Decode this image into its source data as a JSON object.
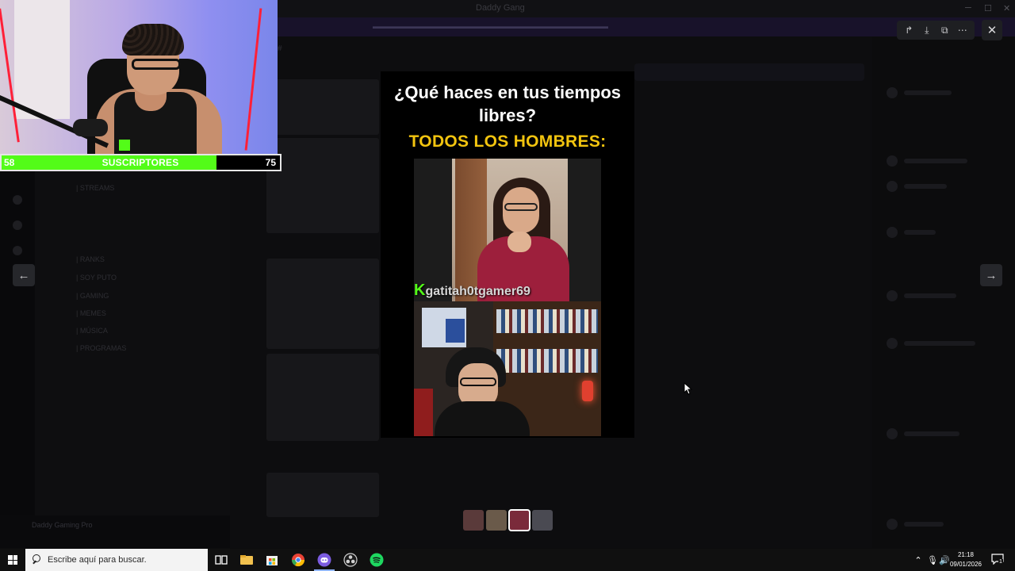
{
  "background_app": {
    "title": "Daddy Gang",
    "channels": [
      "| STREAMS",
      "| RANKS",
      "| SOY PUTO",
      "| GAMING",
      "| MEMES",
      "| MÚSICA",
      "| PROGRAMAS"
    ],
    "user_panel_name": "Daddy Gaming Pro"
  },
  "webcam_overlay": {
    "subs_bar": {
      "current": "58",
      "label": "SUSCRIPTORES",
      "goal": "75",
      "progress_fraction": 0.773
    }
  },
  "media_viewer": {
    "toolbar": {
      "forward_icon": "forward-icon",
      "download_icon": "download-icon",
      "open_external_icon": "open-external-icon",
      "more_icon": "more-icon"
    },
    "close_icon": "close-icon",
    "prev_icon": "arrow-left-icon",
    "next_icon": "arrow-right-icon",
    "meme": {
      "question": "¿Qué haces en tus tiempos libres?",
      "headline": "TODOS LOS HOMBRES:",
      "watermark": "gatitah0tgamer69",
      "watermark_badge": "K"
    },
    "thumbnails": [
      {
        "label": "thumbnail-1",
        "color": "#5a3a3a"
      },
      {
        "label": "thumbnail-2",
        "color": "#6a5a4a"
      },
      {
        "label": "thumbnail-3",
        "color": "#7a2a3a"
      },
      {
        "label": "thumbnail-4",
        "color": "#4a4a52"
      }
    ]
  },
  "taskbar": {
    "search_placeholder": "Escribe aquí para buscar.",
    "apps": [
      {
        "name": "task-view-icon",
        "color": "#ffffff"
      },
      {
        "name": "file-explorer-icon",
        "color": "#f2c14e"
      },
      {
        "name": "store-icon",
        "color": "#3a8ee6"
      },
      {
        "name": "chrome-icon",
        "color": "#e94235"
      },
      {
        "name": "discord-icon",
        "color": "#7c5ce0"
      },
      {
        "name": "obs-icon",
        "color": "#c9c9c9"
      },
      {
        "name": "spotify-icon",
        "color": "#1ed760"
      }
    ],
    "time": "21:18",
    "date": "09/01/2026",
    "notification_count": "1"
  }
}
